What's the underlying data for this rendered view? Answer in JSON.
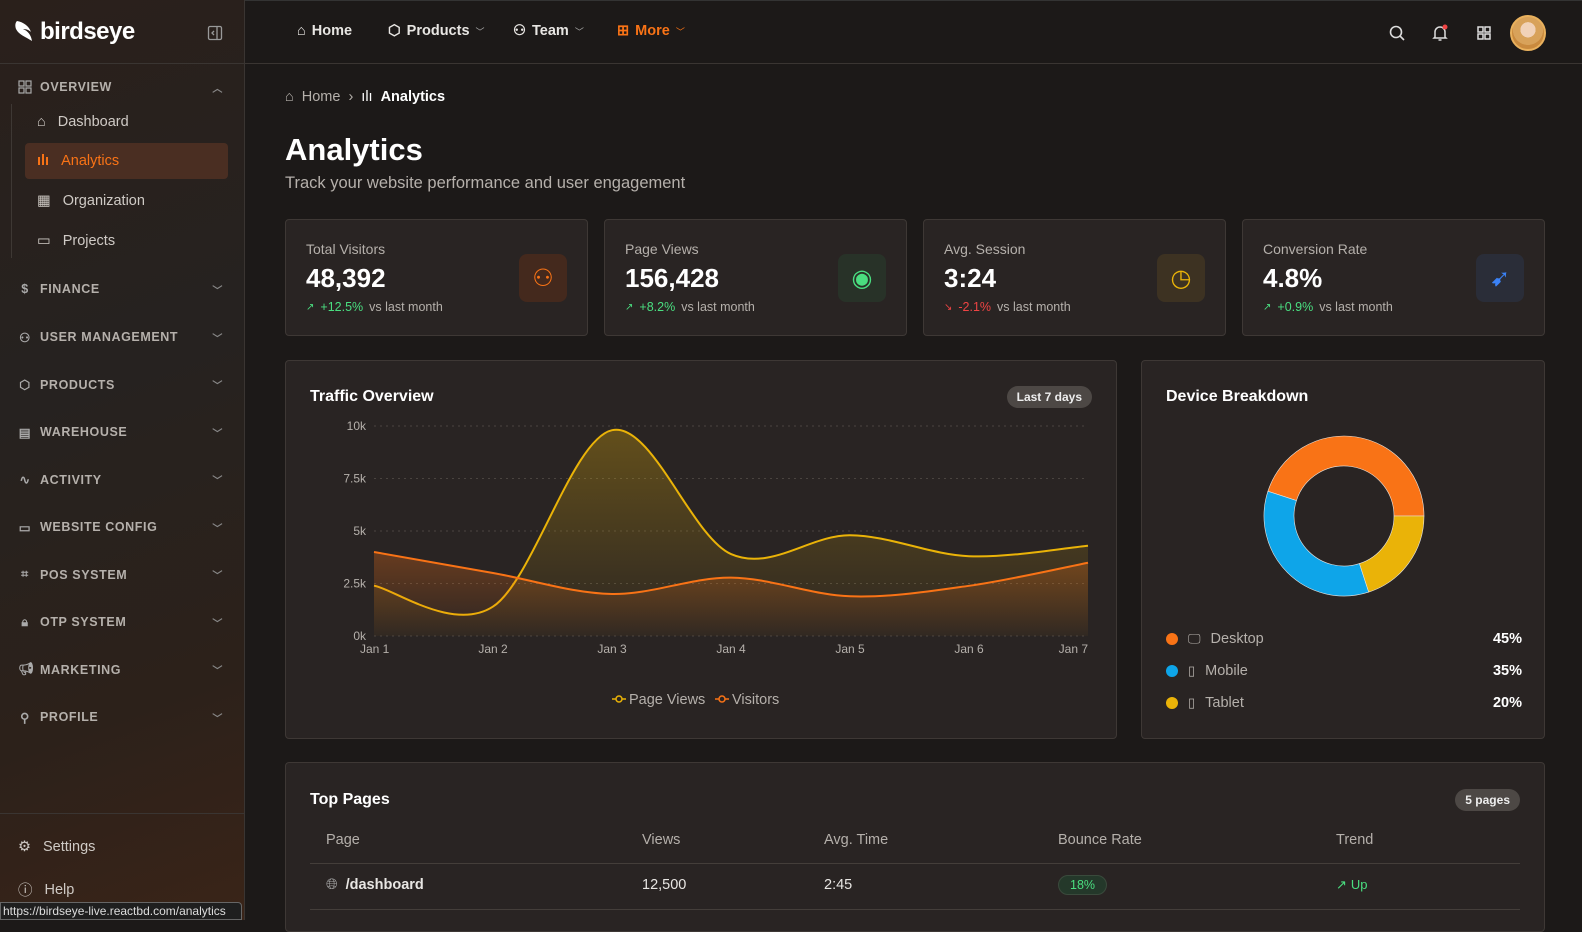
{
  "app": {
    "name": "birdseye",
    "status_url": "https://birdseye-live.reactbd.com/analytics"
  },
  "sidebar": {
    "overview": {
      "label": "OVERVIEW",
      "items": [
        {
          "label": "Dashboard"
        },
        {
          "label": "Analytics"
        },
        {
          "label": "Organization"
        },
        {
          "label": "Projects"
        }
      ]
    },
    "sections": [
      {
        "label": "FINANCE"
      },
      {
        "label": "USER MANAGEMENT"
      },
      {
        "label": "PRODUCTS"
      },
      {
        "label": "WAREHOUSE"
      },
      {
        "label": "ACTIVITY"
      },
      {
        "label": "WEBSITE CONFIG"
      },
      {
        "label": "POS SYSTEM"
      },
      {
        "label": "OTP SYSTEM"
      },
      {
        "label": "MARKETING"
      },
      {
        "label": "PROFILE"
      }
    ],
    "bottom": [
      {
        "label": "Settings"
      },
      {
        "label": "Help"
      }
    ]
  },
  "topnav": [
    {
      "label": "Home"
    },
    {
      "label": "Products"
    },
    {
      "label": "Team"
    },
    {
      "label": "More"
    }
  ],
  "breadcrumb": {
    "home": "Home",
    "current": "Analytics"
  },
  "page": {
    "title": "Analytics",
    "subtitle": "Track your website performance and user engagement"
  },
  "stats": [
    {
      "label": "Total Visitors",
      "value": "48,392",
      "change": "+12.5%",
      "suffix": "vs last month",
      "trend": "up"
    },
    {
      "label": "Page Views",
      "value": "156,428",
      "change": "+8.2%",
      "suffix": "vs last month",
      "trend": "up"
    },
    {
      "label": "Avg. Session",
      "value": "3:24",
      "change": "-2.1%",
      "suffix": "vs last month",
      "trend": "down"
    },
    {
      "label": "Conversion Rate",
      "value": "4.8%",
      "change": "+0.9%",
      "suffix": "vs last month",
      "trend": "up"
    }
  ],
  "colors": {
    "accent": "#f97316",
    "yellow": "#eab308",
    "blue": "#0ea5e9",
    "green": "#4ade80",
    "red": "#ef4444"
  },
  "chart_data": [
    {
      "type": "area",
      "title": "Traffic Overview",
      "badge": "Last 7 days",
      "categories": [
        "Jan 1",
        "Jan 2",
        "Jan 3",
        "Jan 4",
        "Jan 5",
        "Jan 6",
        "Jan 7"
      ],
      "yticks": [
        "0k",
        "2.5k",
        "5k",
        "7.5k",
        "10k"
      ],
      "ylim": [
        0,
        10000
      ],
      "grid": true,
      "legend": "bottom",
      "series": [
        {
          "name": "Page Views",
          "color": "#eab308",
          "values": [
            2400,
            1400,
            9800,
            3900,
            4800,
            3800,
            4300
          ]
        },
        {
          "name": "Visitors",
          "color": "#f97316",
          "values": [
            4000,
            3000,
            2000,
            2780,
            1890,
            2390,
            3490
          ]
        }
      ]
    },
    {
      "type": "pie",
      "title": "Device Breakdown",
      "labels": [
        "Desktop",
        "Mobile",
        "Tablet"
      ],
      "values": [
        45,
        35,
        20
      ],
      "display": [
        "45%",
        "35%",
        "20%"
      ],
      "colors": [
        "#f97316",
        "#0ea5e9",
        "#eab308"
      ]
    }
  ],
  "top_pages": {
    "title": "Top Pages",
    "badge": "5 pages",
    "columns": [
      "Page",
      "Views",
      "Avg. Time",
      "Bounce Rate",
      "Trend"
    ],
    "rows": [
      {
        "page": "/dashboard",
        "views": "12,500",
        "time": "2:45",
        "bounce": "18%",
        "trend": "Up"
      }
    ]
  }
}
